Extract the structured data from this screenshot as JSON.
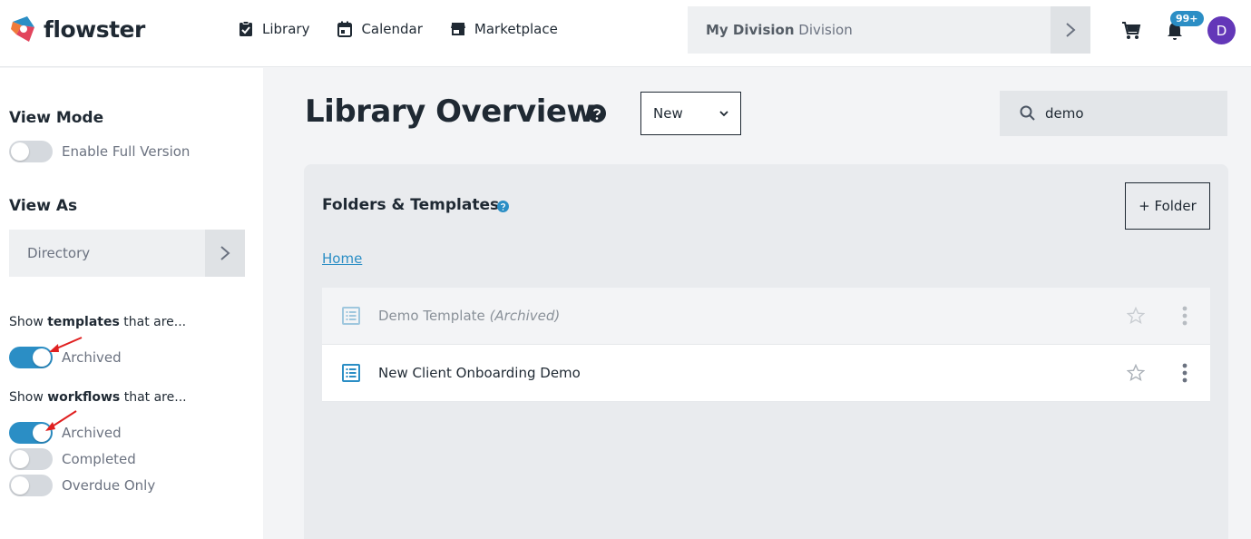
{
  "app": {
    "name": "flowster"
  },
  "nav": [
    {
      "label": "Library",
      "icon": "clipboard-check-icon"
    },
    {
      "label": "Calendar",
      "icon": "calendar-icon"
    },
    {
      "label": "Marketplace",
      "icon": "store-icon"
    }
  ],
  "division": {
    "bold": "My Division",
    "suffix": "Division"
  },
  "header": {
    "badge": "99+",
    "avatar_initial": "D"
  },
  "sidebar": {
    "view_mode_heading": "View Mode",
    "full_version_label": "Enable Full Version",
    "full_version_on": false,
    "view_as_heading": "View As",
    "view_as_value": "Directory",
    "templates_prefix": "Show ",
    "templates_bold": "templates",
    "templates_suffix": " that are...",
    "templates_archived_label": "Archived",
    "templates_archived_on": true,
    "workflows_prefix": "Show ",
    "workflows_bold": "workflows",
    "workflows_suffix": " that are...",
    "workflows_archived_label": "Archived",
    "workflows_archived_on": true,
    "workflows_completed_label": "Completed",
    "workflows_completed_on": false,
    "workflows_overdue_label": "Overdue Only",
    "workflows_overdue_on": false
  },
  "main": {
    "title": "Library Overview",
    "new_select_value": "New",
    "search_value": "demo",
    "panel_title": "Folders & Templates",
    "folder_button": "+ Folder",
    "breadcrumb": "Home",
    "items": [
      {
        "name": "Demo Template",
        "tag": "(Archived)",
        "archived": true
      },
      {
        "name": "New Client Onboarding Demo",
        "tag": "",
        "archived": false
      }
    ]
  },
  "colors": {
    "accent": "#2b8ec5",
    "avatar": "#6337b8",
    "annotation_arrow": "#e02020"
  }
}
